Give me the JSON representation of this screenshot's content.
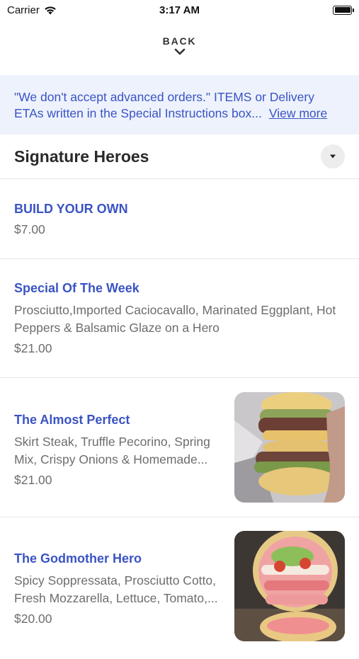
{
  "status_bar": {
    "carrier": "Carrier",
    "time": "3:17 AM"
  },
  "nav": {
    "back_label": "BACK"
  },
  "banner": {
    "text": "\"We don't accept advanced orders.\" ITEMS or Delivery ETAs written in the Special Instructions box...",
    "link_label": "View more"
  },
  "section": {
    "title": "Signature Heroes"
  },
  "items": [
    {
      "name": "BUILD YOUR OWN",
      "description": "",
      "price": "$7.00"
    },
    {
      "name": "Special Of The Week",
      "description": "Prosciutto,Imported Caciocavallo, Marinated Eggplant, Hot Peppers & Balsamic Glaze on a Hero",
      "price": "$21.00"
    },
    {
      "name": "The Almost Perfect",
      "description": "Skirt Steak, Truffle Pecorino, Spring Mix, Crispy Onions & Homemade...",
      "price": "$21.00",
      "photo": "steak-sandwich-photo"
    },
    {
      "name": "The Godmother Hero",
      "description": "Spicy Soppressata, Prosciutto Cotto, Fresh Mozzarella, Lettuce, Tomato,...",
      "price": "$20.00",
      "photo": "italian-hero-photo"
    }
  ],
  "colors": {
    "accent": "#3a54c4",
    "banner_bg": "#eef2fd",
    "muted_text": "#6d6d6d"
  }
}
